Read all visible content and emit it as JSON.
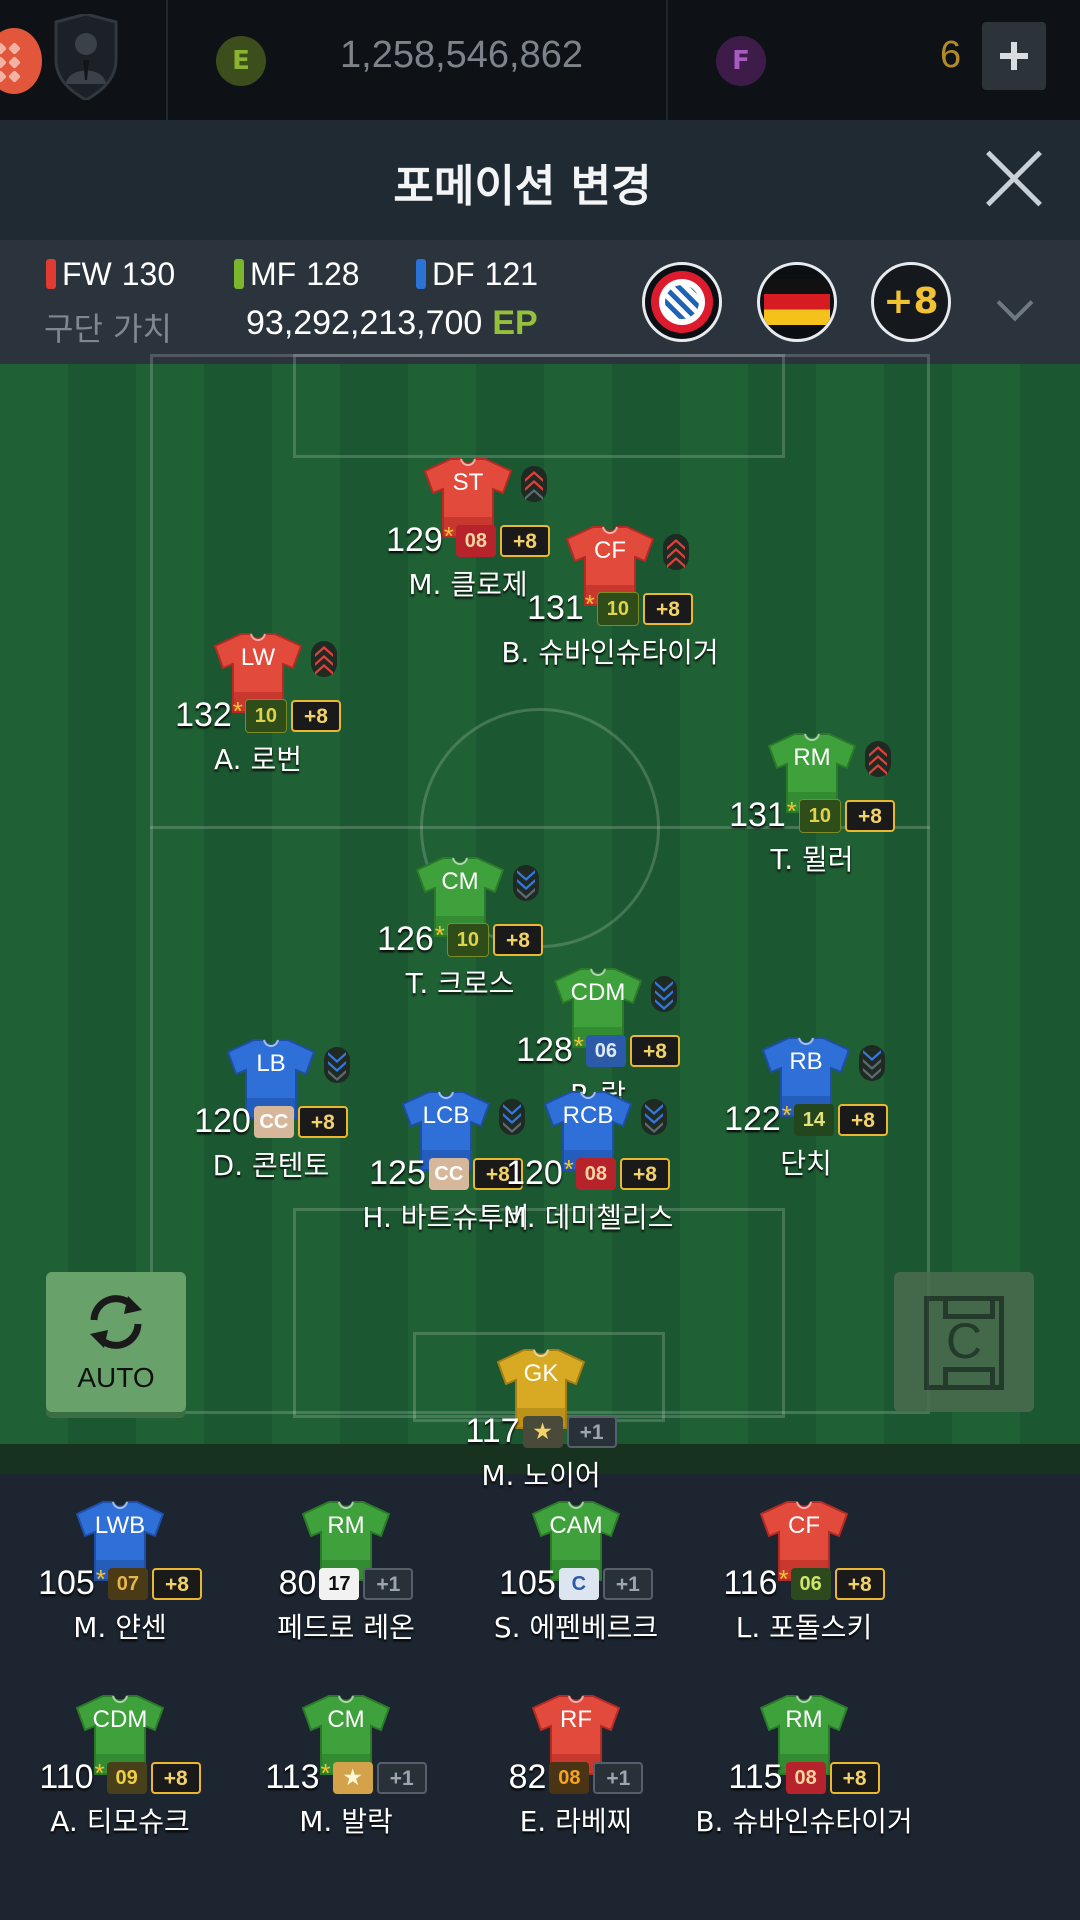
{
  "topbar": {
    "e_label": "E",
    "e_amount": "1,258,546,862",
    "f_label": "F",
    "f_amount": "6"
  },
  "header": {
    "title": "포메이션 변경"
  },
  "stats": {
    "fw_label": "FW",
    "fw_value": "130",
    "mf_label": "MF",
    "mf_value": "128",
    "df_label": "DF",
    "df_value": "121",
    "team_value_label": "구단 가치",
    "team_value": "93,292,213,700",
    "team_value_unit": "EP",
    "boost_badge": "+8",
    "colors": {
      "fw": "#e03a32",
      "mf": "#7ab72c",
      "df": "#2b72d6"
    }
  },
  "controls": {
    "auto_label": "AUTO",
    "c_label": "C"
  },
  "lineup": [
    {
      "pos": "ST",
      "ovr": "129",
      "star": "*",
      "season": "08",
      "up": "+8",
      "name": "M. 클로제",
      "jersey": "red",
      "chem": "up2"
    },
    {
      "pos": "CF",
      "ovr": "131",
      "star": "*",
      "season": "10",
      "up": "+8",
      "name": "B. 슈바인슈타이거",
      "jersey": "red",
      "chem": "up3"
    },
    {
      "pos": "LW",
      "ovr": "132",
      "star": "*",
      "season": "10",
      "up": "+8",
      "name": "A. 로번",
      "jersey": "red",
      "chem": "up3"
    },
    {
      "pos": "RM",
      "ovr": "131",
      "star": "*",
      "season": "10",
      "up": "+8",
      "name": "T. 뮐러",
      "jersey": "green",
      "chem": "up3"
    },
    {
      "pos": "CM",
      "ovr": "126",
      "star": "*",
      "season": "10",
      "up": "+8",
      "name": "T. 크로스",
      "jersey": "green",
      "chem": "down2"
    },
    {
      "pos": "CDM",
      "ovr": "128",
      "star": "*",
      "season": "06",
      "up": "+8",
      "name": "P. 람",
      "jersey": "green",
      "chem": "down3"
    },
    {
      "pos": "LB",
      "ovr": "120",
      "star": "",
      "season": "CC",
      "up": "+8",
      "name": "D. 콘텐토",
      "jersey": "blue",
      "chem": "down2"
    },
    {
      "pos": "RB",
      "ovr": "122",
      "star": "*",
      "season": "14",
      "up": "+8",
      "name": "단치",
      "jersey": "blue",
      "chem": "down1"
    },
    {
      "pos": "LCB",
      "ovr": "125",
      "star": "",
      "season": "CC",
      "up": "+8",
      "name": "H. 바트슈투버",
      "jersey": "blue",
      "chem": "down2"
    },
    {
      "pos": "RCB",
      "ovr": "120",
      "star": "*",
      "season": "08",
      "up": "+8",
      "name": "M. 데미첼리스",
      "jersey": "blue",
      "chem": "down2"
    },
    {
      "pos": "GK",
      "ovr": "117",
      "star": "",
      "season": "★",
      "up": "+1",
      "name": "M. 노이어",
      "jersey": "gold",
      "chem": ""
    }
  ],
  "bench": [
    {
      "pos": "LWB",
      "ovr": "105",
      "star": "*",
      "season": "07",
      "up": "+8",
      "name": "M. 얀센",
      "jersey": "blue"
    },
    {
      "pos": "RM",
      "ovr": "80",
      "star": "",
      "season": "17",
      "up": "+1",
      "name": "페드로 레온",
      "jersey": "green"
    },
    {
      "pos": "CAM",
      "ovr": "105",
      "star": "",
      "season": "C",
      "up": "+1",
      "name": "S. 에펜베르크",
      "jersey": "green"
    },
    {
      "pos": "CF",
      "ovr": "116",
      "star": "*",
      "season": "06",
      "up": "+8",
      "name": "L. 포돌스키",
      "jersey": "red"
    },
    {
      "pos": "CDM",
      "ovr": "110",
      "star": "*",
      "season": "09",
      "up": "+8",
      "name": "A. 티모슈크",
      "jersey": "green"
    },
    {
      "pos": "CM",
      "ovr": "113",
      "star": "*",
      "season": "★",
      "up": "+1",
      "name": "M. 발락",
      "jersey": "green"
    },
    {
      "pos": "RF",
      "ovr": "82",
      "star": "",
      "season": "08",
      "up": "+1",
      "name": "E. 라베찌",
      "jersey": "red"
    },
    {
      "pos": "RM",
      "ovr": "115",
      "star": "",
      "season": "08",
      "up": "+8",
      "name": "B. 슈바인슈타이거",
      "jersey": "green"
    }
  ]
}
